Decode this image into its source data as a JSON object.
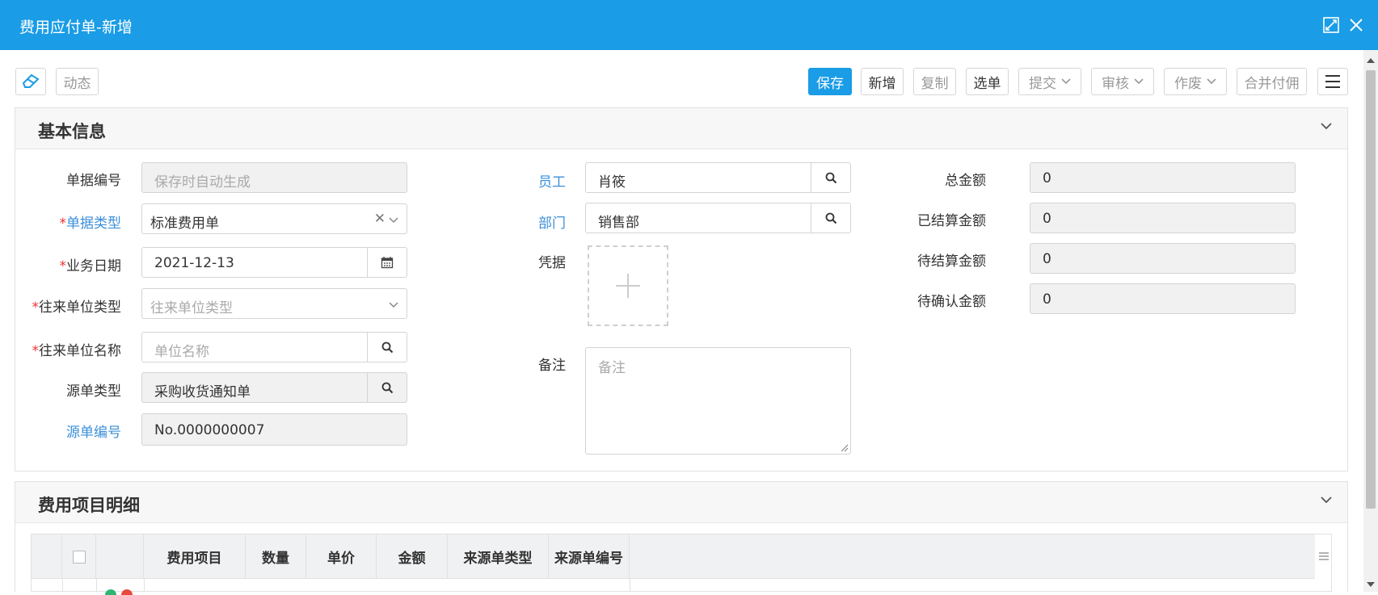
{
  "window": {
    "title": "费用应付单-新增",
    "icons": [
      "maximize-icon",
      "close-icon"
    ]
  },
  "toolbar": {
    "left": {
      "eraser_icon": "eraser-icon",
      "dynamic_label": "动态"
    },
    "buttons": {
      "save": "保存",
      "new": "新增",
      "copy": "复制",
      "select_doc": "选单",
      "submit": "提交",
      "audit": "审核",
      "void": "作废",
      "merge_pay": "合并付佣"
    },
    "menu_icon": "hamburger-menu-icon"
  },
  "basic": {
    "title": "基本信息",
    "left": {
      "doc_no": {
        "label": "单据编号",
        "placeholder": "保存时自动生成"
      },
      "doc_type": {
        "required": "*",
        "label": "单据类型",
        "value": "标准费用单"
      },
      "biz_date": {
        "required": "*",
        "label": "业务日期",
        "value": "2021-12-13"
      },
      "partner_type": {
        "required": "*",
        "label": "往来单位类型",
        "placeholder": "往来单位类型"
      },
      "partner_name": {
        "required": "*",
        "label": "往来单位名称",
        "placeholder": "单位名称"
      },
      "source_type": {
        "label": "源单类型",
        "value": "采购收货通知单"
      },
      "source_no": {
        "label": "源单编号",
        "value": "No.0000000007"
      }
    },
    "middle": {
      "employee": {
        "label": "员工",
        "value": "肖筱"
      },
      "department": {
        "label": "部门",
        "value": "销售部"
      },
      "voucher": {
        "label": "凭据"
      },
      "remark": {
        "label": "备注",
        "placeholder": "备注"
      }
    },
    "right": {
      "total": {
        "label": "总金额",
        "value": "0"
      },
      "settled": {
        "label": "已结算金额",
        "value": "0"
      },
      "to_settle": {
        "label": "待结算金额",
        "value": "0"
      },
      "to_confirm": {
        "label": "待确认金额",
        "value": "0"
      }
    }
  },
  "detail": {
    "title": "费用项目明细",
    "columns": [
      "费用项目",
      "数量",
      "单价",
      "金额",
      "来源单类型",
      "来源单编号"
    ]
  },
  "colors": {
    "titlebar": "#1a9ce6",
    "primary_button": "#1a9ce6",
    "link_label": "#3b8fd9",
    "required_mark": "#ee3333"
  }
}
